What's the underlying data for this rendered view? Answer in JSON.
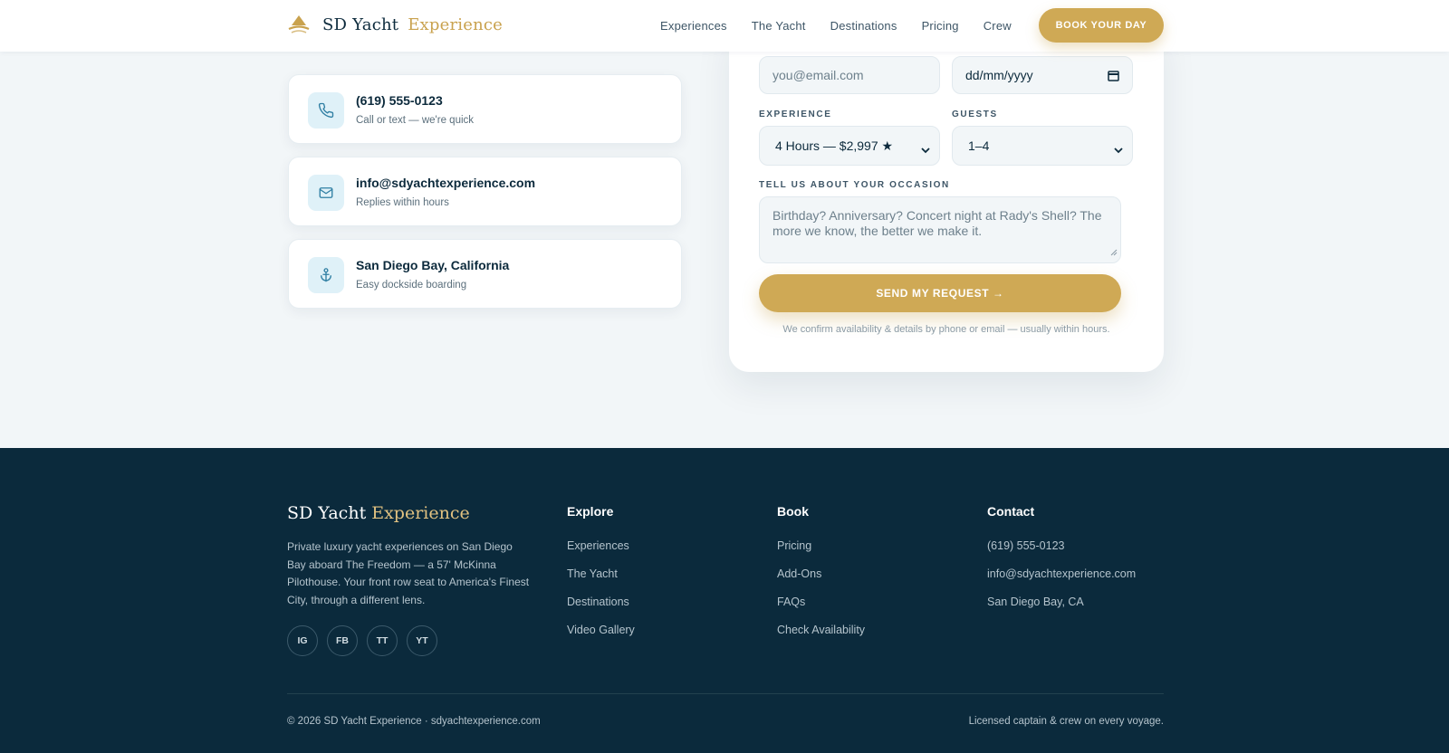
{
  "header": {
    "brand_name": "SD Yacht",
    "brand_accent": "Experience",
    "nav": [
      "Experiences",
      "The Yacht",
      "Destinations",
      "Pricing",
      "Crew"
    ],
    "cta_label": "BOOK YOUR DAY"
  },
  "contact_cards": [
    {
      "title": "(619) 555-0123",
      "subtitle": "Call or text — we're quick",
      "icon": "phone-icon"
    },
    {
      "title": "info@sdyachtexperience.com",
      "subtitle": "Replies within hours",
      "icon": "mail-icon"
    },
    {
      "title": "San Diego Bay, California",
      "subtitle": "Easy dockside boarding",
      "icon": "anchor-icon"
    }
  ],
  "form": {
    "email_placeholder": "you@email.com",
    "date_placeholder": "dd/mm/yyyy",
    "experience_label": "EXPERIENCE",
    "experience_value": "4 Hours — $2,997 ★",
    "guests_label": "GUESTS",
    "guests_value": "1–4",
    "occasion_label": "TELL US ABOUT YOUR OCCASION",
    "occasion_placeholder": "Birthday? Anniversary? Concert night at Rady's Shell? The more we know, the better we make it.",
    "submit_label": "SEND MY REQUEST →",
    "note": "We confirm availability & details by phone or email — usually within hours."
  },
  "footer": {
    "brand_name": "SD Yacht",
    "brand_accent": "Experience",
    "description": "Private luxury yacht experiences on San Diego Bay aboard The Freedom — a 57' McKinna Pilothouse. Your front row seat to America's Finest City, through a different lens.",
    "socials": [
      "IG",
      "FB",
      "TT",
      "YT"
    ],
    "columns": [
      {
        "title": "Explore",
        "links": [
          "Experiences",
          "The Yacht",
          "Destinations",
          "Video Gallery"
        ]
      },
      {
        "title": "Book",
        "links": [
          "Pricing",
          "Add-Ons",
          "FAQs",
          "Check Availability"
        ]
      },
      {
        "title": "Contact",
        "links": [
          "(619) 555-0123",
          "info@sdyachtexperience.com",
          "San Diego Bay, CA"
        ]
      }
    ],
    "copyright": "© 2026 SD Yacht Experience · sdyachtexperience.com",
    "license": "Licensed captain & crew on every voyage."
  },
  "colors": {
    "navy": "#0b2a3c",
    "gold": "#cfa955",
    "background": "#f2f6f8",
    "icon_bg": "#dff1f8",
    "icon_stroke": "#2f7fa3"
  }
}
